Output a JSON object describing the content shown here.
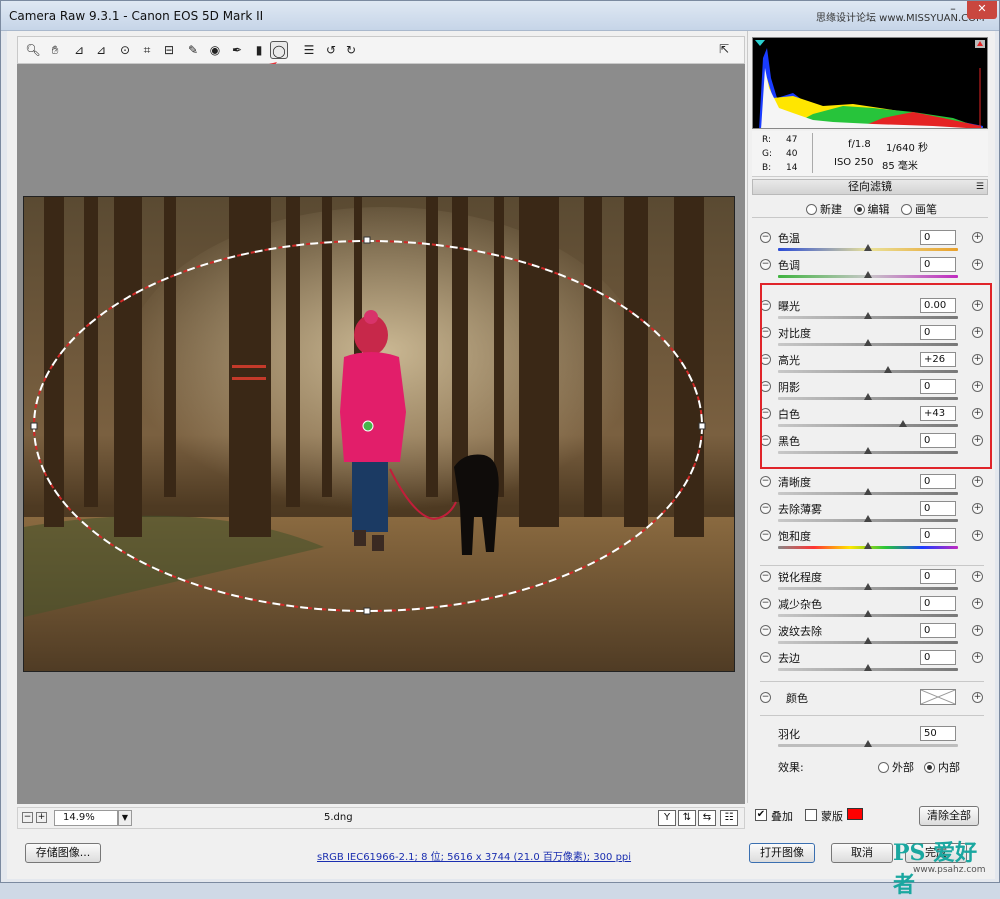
{
  "window": {
    "title": "Camera Raw 9.3.1 -  Canon EOS 5D Mark II",
    "watermark_top": "思缘设计论坛 www.MISSYUAN.COM",
    "min_label": "–",
    "max_label": "□",
    "close_label": "✕"
  },
  "toolbar": {
    "tools": [
      {
        "name": "zoom-tool",
        "glyph": "🔍︎"
      },
      {
        "name": "hand-tool",
        "glyph": "✋︎"
      },
      {
        "name": "white-balance-tool",
        "glyph": "⊿"
      },
      {
        "name": "color-sampler-tool",
        "glyph": "⊿"
      },
      {
        "name": "targeted-adjustment-tool",
        "glyph": "⊙"
      },
      {
        "name": "crop-tool",
        "glyph": "⌗"
      },
      {
        "name": "straighten-tool",
        "glyph": "⊟"
      },
      {
        "name": "spot-removal-tool",
        "glyph": "✎"
      },
      {
        "name": "red-eye-tool",
        "glyph": "◉"
      },
      {
        "name": "adjustment-brush-tool",
        "glyph": "✒"
      },
      {
        "name": "graduated-filter-tool",
        "glyph": "▮"
      },
      {
        "name": "radial-filter-tool",
        "glyph": "◯"
      },
      {
        "name": "preferences-tool",
        "glyph": "☰"
      },
      {
        "name": "rotate-ccw-tool",
        "glyph": "↺"
      },
      {
        "name": "rotate-cw-tool",
        "glyph": "↻"
      }
    ],
    "fullscreen_glyph": "⇱"
  },
  "status": {
    "zoom": "14.9%",
    "filename": "5.dng"
  },
  "histogram": {
    "r_label": "R:",
    "r_value": "47",
    "g_label": "G:",
    "g_value": "40",
    "b_label": "B:",
    "b_value": "14",
    "aperture": "f/1.8",
    "shutter": "1/640 秒",
    "iso": "ISO 250",
    "focal": "85 毫米"
  },
  "panel": {
    "title": "径向滤镜",
    "mode_new": "新建",
    "mode_edit": "编辑",
    "mode_brush": "画笔",
    "sliders": [
      {
        "label": "色温",
        "value": "0"
      },
      {
        "label": "色调",
        "value": "0"
      },
      {
        "label": "曝光",
        "value": "0.00"
      },
      {
        "label": "对比度",
        "value": "0"
      },
      {
        "label": "高光",
        "value": "+26"
      },
      {
        "label": "阴影",
        "value": "0"
      },
      {
        "label": "白色",
        "value": "+43"
      },
      {
        "label": "黑色",
        "value": "0"
      },
      {
        "label": "清晰度",
        "value": "0"
      },
      {
        "label": "去除薄雾",
        "value": "0"
      },
      {
        "label": "饱和度",
        "value": "0"
      },
      {
        "label": "锐化程度",
        "value": "0"
      },
      {
        "label": "减少杂色",
        "value": "0"
      },
      {
        "label": "波纹去除",
        "value": "0"
      },
      {
        "label": "去边",
        "value": "0"
      }
    ],
    "color_label": "颜色",
    "feather_label": "羽化",
    "feather_value": "50",
    "effect_label": "效果:",
    "effect_outer": "外部",
    "effect_inner": "内部",
    "overlay_label": "叠加",
    "mask_label": "蒙版",
    "clear_all": "清除全部"
  },
  "bottom": {
    "save_button": "存储图像...",
    "workflow_link": "sRGB IEC61966-2.1; 8 位; 5616 x 3744 (21.0 百万像素); 300 ppi",
    "open_button": "打开图像",
    "cancel_button": "取消",
    "done_button": "完成",
    "watermark_logo": "PS 爱好者",
    "watermark_url": "www.psahz.com"
  },
  "colors": {
    "highlight_box": "#e0242a",
    "arrow": "#e8333a",
    "mask_swatch": "#ff0000"
  }
}
